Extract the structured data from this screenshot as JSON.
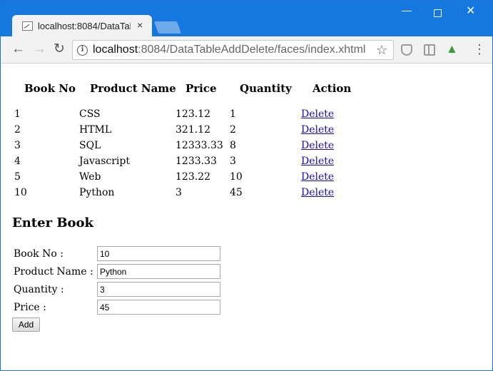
{
  "browser": {
    "tab_title": "localhost:8084/DataTal",
    "tab_close": "×",
    "url_host": "localhost",
    "url_rest": ":8084/DataTableAddDelete/faces/index.xhtml",
    "icons": [
      "page-favicon",
      "back-icon",
      "forward-icon",
      "reload-icon",
      "info-icon",
      "star-icon",
      "shield-extension-icon",
      "reader-icon",
      "tree-extension-icon",
      "menu-icon"
    ]
  },
  "table": {
    "headers": [
      "Book No",
      "Product Name",
      "Price",
      "Quantity",
      "Action"
    ],
    "rows": [
      {
        "book_no": "1",
        "product_name": "CSS",
        "price": "123.12",
        "quantity": "1",
        "action": "Delete"
      },
      {
        "book_no": "2",
        "product_name": "HTML",
        "price": "321.12",
        "quantity": "2",
        "action": "Delete"
      },
      {
        "book_no": "3",
        "product_name": "SQL",
        "price": "12333.33",
        "quantity": "8",
        "action": "Delete"
      },
      {
        "book_no": "4",
        "product_name": "Javascript",
        "price": "1233.33",
        "quantity": "3",
        "action": "Delete"
      },
      {
        "book_no": "5",
        "product_name": "Web",
        "price": "123.22",
        "quantity": "10",
        "action": "Delete"
      },
      {
        "book_no": "10",
        "product_name": "Python",
        "price": "3",
        "quantity": "45",
        "action": "Delete"
      }
    ]
  },
  "form": {
    "title": "Enter Book",
    "fields": [
      {
        "label": "Book No :",
        "value": "10"
      },
      {
        "label": "Product Name :",
        "value": "Python"
      },
      {
        "label": "Quantity :",
        "value": "3"
      },
      {
        "label": "Price :",
        "value": "45"
      }
    ],
    "add_label": "Add"
  }
}
